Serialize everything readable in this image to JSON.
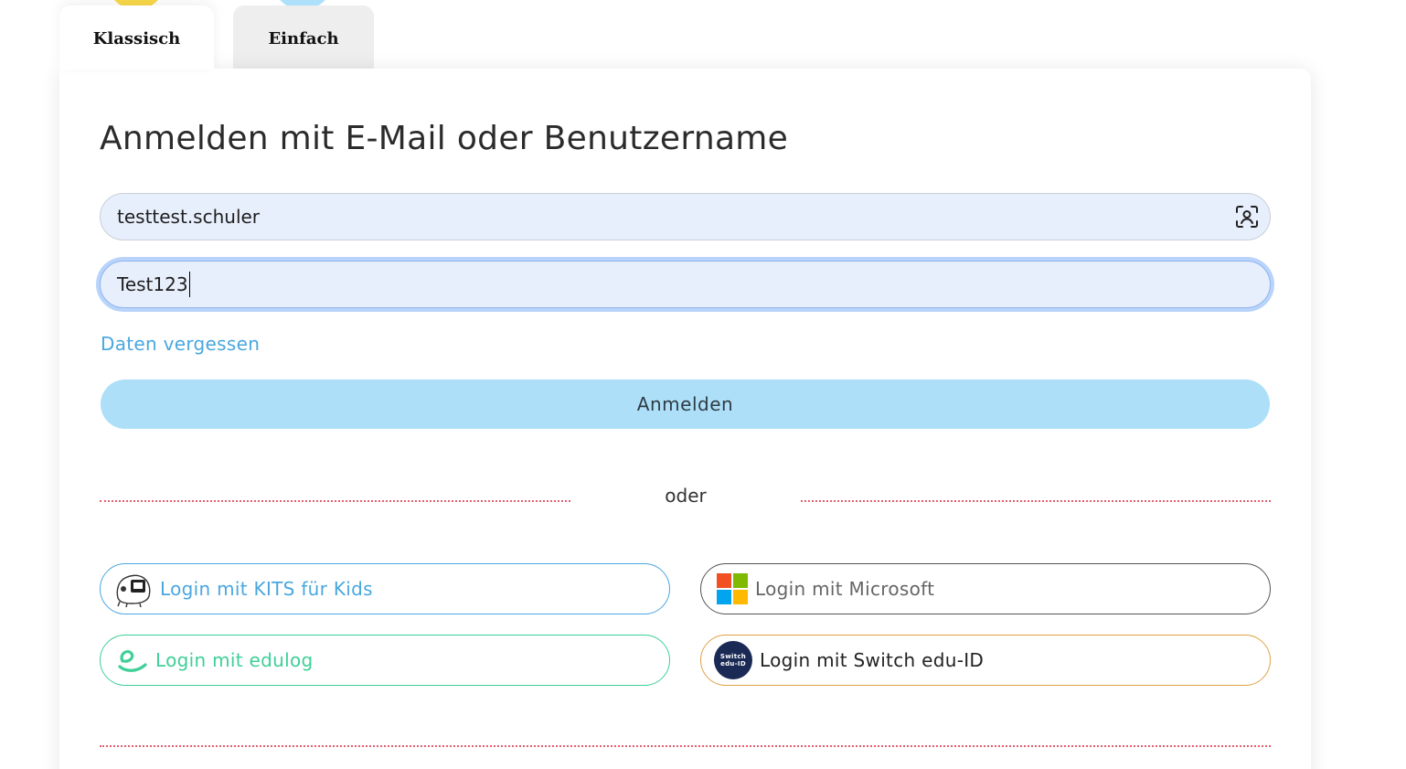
{
  "tabs": [
    {
      "label": "Klassisch",
      "active": true
    },
    {
      "label": "Einfach",
      "active": false
    }
  ],
  "login": {
    "title": "Anmelden mit E-Mail oder Benutzername",
    "username_value": "testtest.schuler",
    "password_value": "Test123",
    "forgot_label": "Daten vergessen",
    "submit_label": "Anmelden",
    "separator_label": "oder"
  },
  "sso": {
    "kits": {
      "label": "Login mit KITS für Kids",
      "icon": "kits-logo-icon"
    },
    "microsoft": {
      "label": "Login mit Microsoft",
      "icon": "microsoft-logo-icon"
    },
    "edulog": {
      "label": "Login mit edulog",
      "icon": "edulog-logo-icon"
    },
    "switch": {
      "label": "Login mit Switch edu-ID",
      "icon": "switch-edu-id-logo-icon",
      "badge_text": "Switch edu-ID"
    }
  },
  "colors": {
    "accent_blue": "#4aa7df",
    "submit_bg": "#ade0f8",
    "edulog_green": "#3fcf98",
    "switch_orange": "#e0a246",
    "divider_red": "#e06070",
    "input_bg": "#e8effc"
  }
}
